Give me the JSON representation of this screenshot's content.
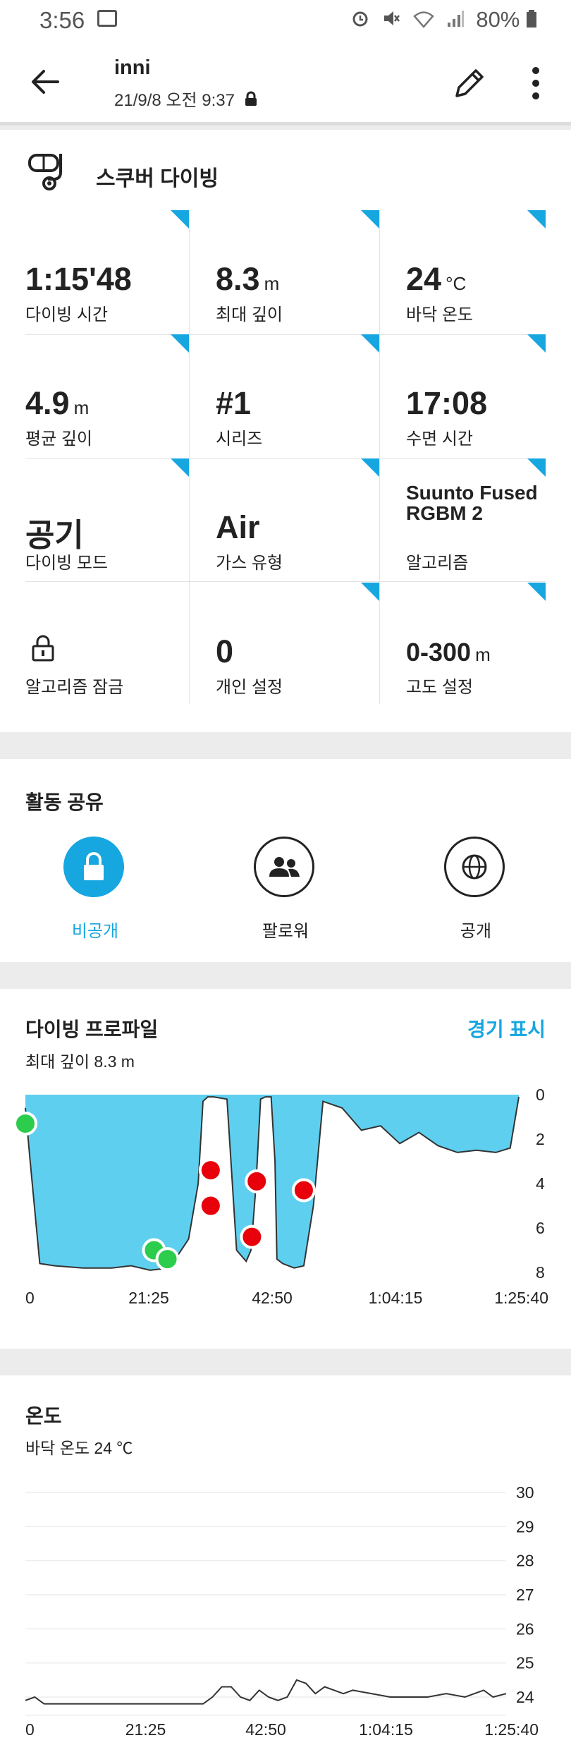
{
  "status_bar": {
    "time": "3:56",
    "battery": "80%"
  },
  "header": {
    "user": "inni",
    "datetime": "21/9/8 오전 9:37"
  },
  "activity": {
    "title": "스쿠버 다이빙",
    "stats": [
      {
        "value": "1:15'48",
        "unit": "",
        "label": "다이빙 시간"
      },
      {
        "value": "8.3",
        "unit": "m",
        "label": "최대 깊이"
      },
      {
        "value": "24",
        "unit": "°C",
        "label": "바닥 온도"
      },
      {
        "value": "4.9",
        "unit": "m",
        "label": "평균 깊이"
      },
      {
        "value": "#1",
        "unit": "",
        "label": "시리즈"
      },
      {
        "value": "17:08",
        "unit": "",
        "label": "수면 시간"
      },
      {
        "value": "공기",
        "unit": "",
        "label": "다이빙 모드"
      },
      {
        "value": "Air",
        "unit": "",
        "label": "가스 유형"
      },
      {
        "value": "Suunto Fused RGBM 2",
        "unit": "",
        "label": "알고리즘"
      },
      {
        "value": "",
        "unit": "",
        "label": "알고리즘 잠금"
      },
      {
        "value": "0",
        "unit": "",
        "label": "개인 설정"
      },
      {
        "value": "0-300",
        "unit": "m",
        "label": "고도 설정"
      }
    ]
  },
  "sharing": {
    "title": "활동 공유",
    "options": [
      {
        "label": "비공개",
        "selected": true
      },
      {
        "label": "팔로워",
        "selected": false
      },
      {
        "label": "공개",
        "selected": false
      }
    ]
  },
  "dive_profile": {
    "title": "다이빙 프로파일",
    "subtitle": "최대 깊이 8.3 m",
    "link": "경기 표시"
  },
  "temperature": {
    "title": "온도",
    "subtitle": "바닥 온도 24 ℃"
  },
  "colors": {
    "accent": "#16a6e0",
    "fill": "#5fcff0",
    "red": "#e8000b",
    "green": "#2ccc4c"
  },
  "chart_data": [
    {
      "type": "area",
      "title": "다이빙 프로파일",
      "x_ticks": [
        "0",
        "21:25",
        "42:50",
        "1:04:15",
        "1:25:40"
      ],
      "xlim": [
        0,
        5140
      ],
      "y_ticks": [
        "0",
        "2",
        "4",
        "6",
        "8"
      ],
      "ylim": [
        8,
        0
      ],
      "series": [
        {
          "x": [
            0,
            50,
            150,
            300,
            600,
            900,
            1100,
            1300,
            1500,
            1700,
            1800,
            1850,
            1900,
            1930,
            1960,
            2100,
            2200,
            2300,
            2350,
            2400,
            2450,
            2500,
            2520,
            2560,
            2600,
            2620,
            2680,
            2800,
            2900,
            3000,
            3100,
            3300,
            3500,
            3700,
            3900,
            4100,
            4300,
            4500,
            4700,
            4900,
            5050,
            5140
          ],
          "y": [
            0.6,
            3.0,
            7.6,
            7.7,
            7.8,
            7.8,
            7.7,
            7.9,
            7.8,
            6.5,
            4.0,
            0.3,
            0.1,
            0.1,
            0.1,
            0.2,
            7.0,
            7.5,
            7.0,
            4.2,
            0.2,
            0.1,
            0.1,
            0.1,
            3.0,
            7.4,
            7.6,
            7.8,
            7.7,
            5.0,
            0.3,
            0.6,
            1.6,
            1.4,
            2.2,
            1.7,
            2.3,
            2.6,
            2.5,
            2.6,
            2.4,
            0.1
          ]
        }
      ],
      "markers": [
        {
          "x": 0,
          "y": 1.3,
          "color": "green"
        },
        {
          "x": 1340,
          "y": 7.0,
          "color": "green"
        },
        {
          "x": 1480,
          "y": 7.4,
          "color": "green"
        },
        {
          "x": 1930,
          "y": 3.4,
          "color": "red"
        },
        {
          "x": 1930,
          "y": 5.0,
          "color": "red"
        },
        {
          "x": 2410,
          "y": 3.9,
          "color": "red"
        },
        {
          "x": 2360,
          "y": 6.4,
          "color": "red"
        },
        {
          "x": 2900,
          "y": 4.3,
          "color": "red"
        }
      ]
    },
    {
      "type": "line",
      "title": "온도",
      "x_ticks": [
        "0",
        "21:25",
        "42:50",
        "1:04:15",
        "1:25:40"
      ],
      "xlim": [
        0,
        5140
      ],
      "y_ticks": [
        "30",
        "29",
        "28",
        "27",
        "26",
        "25",
        "24"
      ],
      "ylim": [
        23.8,
        30
      ],
      "series": [
        {
          "x": [
            0,
            100,
            200,
            400,
            600,
            800,
            1000,
            1300,
            1600,
            1900,
            2000,
            2100,
            2200,
            2300,
            2400,
            2500,
            2600,
            2700,
            2800,
            2900,
            3000,
            3100,
            3200,
            3300,
            3400,
            3500,
            3700,
            3900,
            4100,
            4300,
            4500,
            4700,
            4900,
            5000,
            5140
          ],
          "y": [
            23.9,
            24.0,
            23.8,
            23.8,
            23.8,
            23.8,
            23.8,
            23.8,
            23.8,
            23.8,
            24.0,
            24.3,
            24.3,
            24.0,
            23.9,
            24.2,
            24.0,
            23.9,
            24.0,
            24.5,
            24.4,
            24.1,
            24.3,
            24.2,
            24.1,
            24.2,
            24.1,
            24.0,
            24.0,
            24.0,
            24.1,
            24.0,
            24.2,
            24.0,
            24.1
          ]
        }
      ]
    }
  ]
}
